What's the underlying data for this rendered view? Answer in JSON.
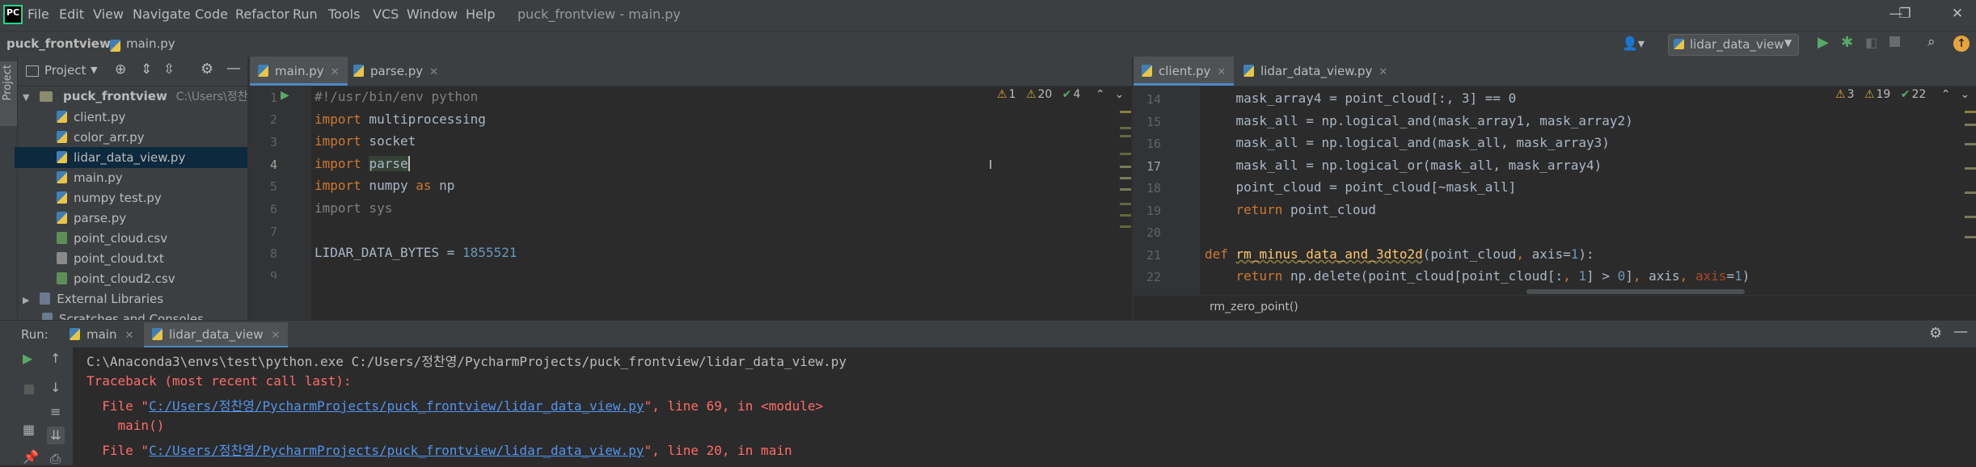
{
  "app": {
    "logo": "PC",
    "menu": [
      "File",
      "Edit",
      "View",
      "Navigate",
      "Code",
      "Refactor",
      "Run",
      "Tools",
      "VCS",
      "Window",
      "Help"
    ],
    "window_title": "puck_frontview - main.py"
  },
  "navbar": {
    "project": "puck_frontview",
    "file": "main.py",
    "run_config": "lidar_data_view"
  },
  "project_panel": {
    "title": "Project",
    "root_name": "puck_frontview",
    "root_path": "C:\\Users\\정찬영",
    "files": [
      {
        "name": "client.py",
        "type": "py"
      },
      {
        "name": "color_arr.py",
        "type": "py"
      },
      {
        "name": "lidar_data_view.py",
        "type": "py",
        "selected": true
      },
      {
        "name": "main.py",
        "type": "py"
      },
      {
        "name": "numpy test.py",
        "type": "py"
      },
      {
        "name": "parse.py",
        "type": "py"
      },
      {
        "name": "point_cloud.csv",
        "type": "csv"
      },
      {
        "name": "point_cloud.txt",
        "type": "txt"
      },
      {
        "name": "point_cloud2.csv",
        "type": "csv"
      }
    ],
    "external": "External Libraries",
    "scratches": "Scratches and Consoles"
  },
  "left_editor": {
    "tabs": [
      "main.py",
      "parse.py"
    ],
    "inspections": {
      "warnings": "1",
      "weak": "20",
      "ok": "4"
    },
    "lines": [
      {
        "n": "1",
        "code": "#!/usr/bin/env python"
      },
      {
        "n": "2",
        "code": "import multiprocessing"
      },
      {
        "n": "3",
        "code": "import socket"
      },
      {
        "n": "4",
        "code": "import parse"
      },
      {
        "n": "5",
        "code": "import numpy as np"
      },
      {
        "n": "6",
        "code": "import sys"
      },
      {
        "n": "7",
        "code": ""
      },
      {
        "n": "8",
        "code": "LIDAR_DATA_BYTES = 1855521"
      },
      {
        "n": "9",
        "code": ""
      }
    ]
  },
  "right_editor": {
    "tabs": [
      "client.py",
      "lidar_data_view.py"
    ],
    "inspections": {
      "warnings": "3",
      "weak": "19",
      "ok": "22"
    },
    "lines": [
      {
        "n": "14",
        "code": "    mask_array4 = point_cloud[:, 3] == 0"
      },
      {
        "n": "15",
        "code": "    mask_all = np.logical_and(mask_array1, mask_array2)"
      },
      {
        "n": "16",
        "code": "    mask_all = np.logical_and(mask_all, mask_array3)"
      },
      {
        "n": "17",
        "code": "    mask_all = np.logical_or(mask_all, mask_array4)"
      },
      {
        "n": "18",
        "code": "    point_cloud = point_cloud[~mask_all]"
      },
      {
        "n": "19",
        "code": "    return point_cloud"
      },
      {
        "n": "20",
        "code": ""
      },
      {
        "n": "21",
        "code": "def rm_minus_data_and_3dto2d(point_cloud, axis=1):"
      },
      {
        "n": "22",
        "code": "    return np.delete(point_cloud[point_cloud[:, 1] > 0], axis, axis=1)"
      }
    ],
    "breadcrumb": "rm_zero_point()"
  },
  "run": {
    "label": "Run:",
    "tabs": [
      "main",
      "lidar_data_view"
    ],
    "output": {
      "cmd": "C:\\Anaconda3\\envs\\test\\python.exe C:/Users/정찬영/PycharmProjects/puck_frontview/lidar_data_view.py",
      "traceback": "Traceback (most recent call last):",
      "file_prefix": "  File \"",
      "path": "C:/Users/정찬영/PycharmProjects/puck_frontview/lidar_data_view.py",
      "line1_suffix": "\", line 69, in <module>",
      "call1": "    main()",
      "line2_suffix": "\", line 20, in main"
    }
  }
}
